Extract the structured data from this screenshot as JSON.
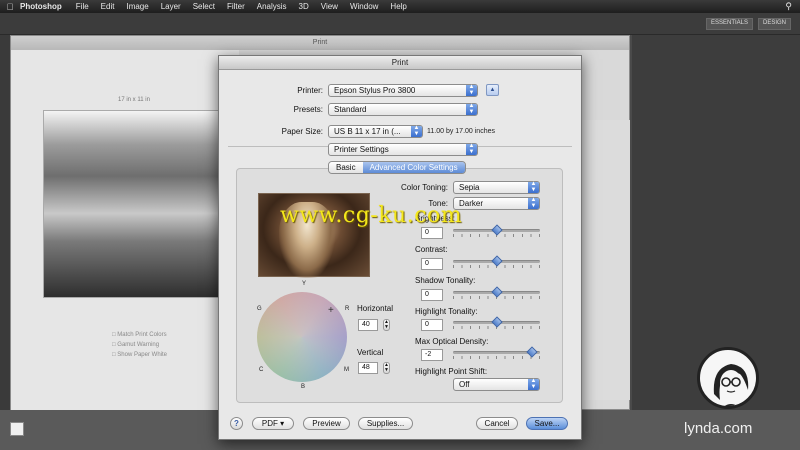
{
  "menubar": {
    "app": "Photoshop",
    "items": [
      "File",
      "Edit",
      "Image",
      "Layer",
      "Select",
      "Filter",
      "Analysis",
      "3D",
      "View",
      "Window",
      "Help"
    ]
  },
  "workspace": {
    "essentials": "ESSENTIALS",
    "design": "DESIGN"
  },
  "background_print": {
    "title": "Print",
    "size_label": "17 in x 11 in",
    "checks": [
      "Match Print Colors",
      "Gamut Warning",
      "Show Paper White"
    ]
  },
  "dialog": {
    "title": "Print",
    "printer_label": "Printer:",
    "printer_value": "Epson Stylus Pro 3800",
    "presets_label": "Presets:",
    "presets_value": "Standard",
    "paper_label": "Paper Size:",
    "paper_value": "US B 11 x 17 in (...",
    "paper_info": "11.00 by 17.00 inches",
    "panel_value": "Printer Settings",
    "tabs": [
      "Basic",
      "Advanced Color Settings"
    ],
    "active_tab": 1,
    "color_toning_label": "Color Toning:",
    "color_toning_value": "Sepia",
    "tone_label": "Tone:",
    "tone_value": "Darker",
    "axis": {
      "y": "Y",
      "g": "G",
      "r": "R",
      "c": "C",
      "m": "M",
      "b": "B"
    },
    "horizontal_label": "Horizontal",
    "horizontal_value": "40",
    "vertical_label": "Vertical",
    "vertical_value": "48",
    "sliders": [
      {
        "label": "Brightness:",
        "value": "0",
        "level": 0.5
      },
      {
        "label": "Contrast:",
        "value": "0",
        "level": 0.5
      },
      {
        "label": "Shadow Tonality:",
        "value": "0",
        "level": 0.5
      },
      {
        "label": "Highlight Tonality:",
        "value": "0",
        "level": 0.5
      },
      {
        "label": "Max Optical Density:",
        "value": "-2",
        "level": 0.95
      }
    ],
    "highlight_shift_label": "Highlight Point Shift:",
    "highlight_shift_value": "Off",
    "buttons": {
      "help": "?",
      "pdf": "PDF ▾",
      "preview": "Preview",
      "supplies": "Supplies...",
      "cancel": "Cancel",
      "save": "Save..."
    }
  },
  "watermark": "www.cg-ku.com",
  "brand": {
    "text": "lynda.com"
  },
  "colors": {
    "accent": "#5b8ed9",
    "watermark": "#f4e71b"
  }
}
